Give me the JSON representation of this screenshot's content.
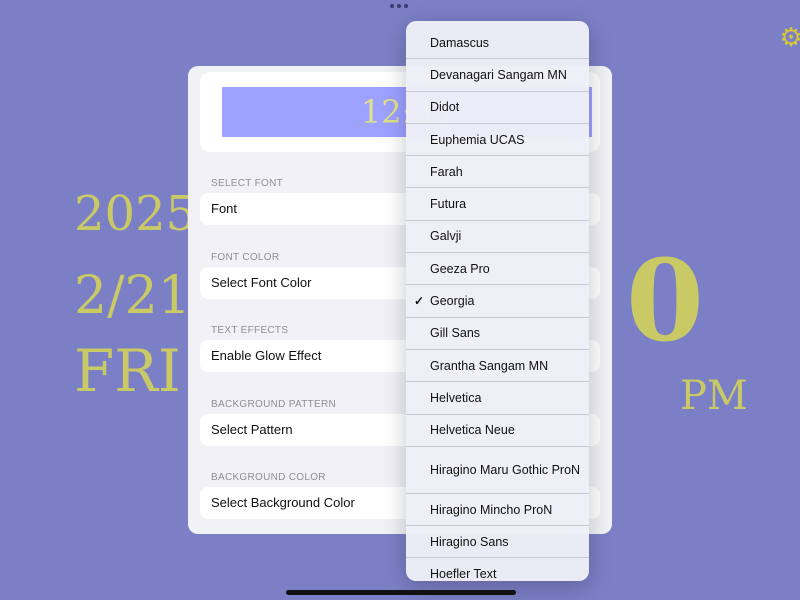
{
  "background": {
    "year": "2025",
    "date": "2/21",
    "day": "FRI",
    "time_digit": "0",
    "ampm": "PM"
  },
  "preview": {
    "clock_text": "12:34"
  },
  "settings": {
    "sections": [
      {
        "header": "SELECT FONT",
        "row_label": "Font"
      },
      {
        "header": "FONT COLOR",
        "row_label": "Select Font Color"
      },
      {
        "header": "TEXT EFFECTS",
        "row_label": "Enable Glow Effect"
      },
      {
        "header": "BACKGROUND PATTERN",
        "row_label": "Select Pattern"
      },
      {
        "header": "BACKGROUND COLOR",
        "row_label": "Select Background Color"
      }
    ]
  },
  "font_menu": {
    "selected": "Georgia",
    "items": [
      "Damascus",
      "Devanagari Sangam MN",
      "Didot",
      "Euphemia UCAS",
      "Farah",
      "Futura",
      "Galvji",
      "Geeza Pro",
      "Georgia",
      "Gill Sans",
      "Grantha Sangam MN",
      "Helvetica",
      "Helvetica Neue",
      "Hiragino Maru Gothic ProN",
      "Hiragino Mincho ProN",
      "Hiragino Sans",
      "Hoefler Text"
    ],
    "check_glyph": "✓"
  },
  "icons": {
    "settings": "gear-icon"
  },
  "colors": {
    "background": "#7b7fc6",
    "clock_text": "#c9c966",
    "preview_bg": "#9da1ff"
  }
}
